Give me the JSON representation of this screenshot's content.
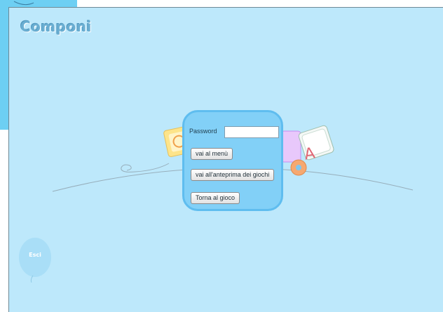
{
  "app": {
    "title": "Componi"
  },
  "login": {
    "password_label": "Password",
    "password_value": ""
  },
  "buttons": {
    "menu": "vai al menù",
    "preview": "vai all'anteprima dei giochi",
    "back": "Torna al gioco"
  },
  "exit": {
    "label": "Esci"
  },
  "decorations": {
    "block_letter": "A"
  },
  "colors": {
    "background": "#bde8fb",
    "corner_accent": "#6dcff3",
    "dialog_fill": "#82d0f7",
    "dialog_border": "#5fbdef",
    "title": "#6aaed2"
  }
}
